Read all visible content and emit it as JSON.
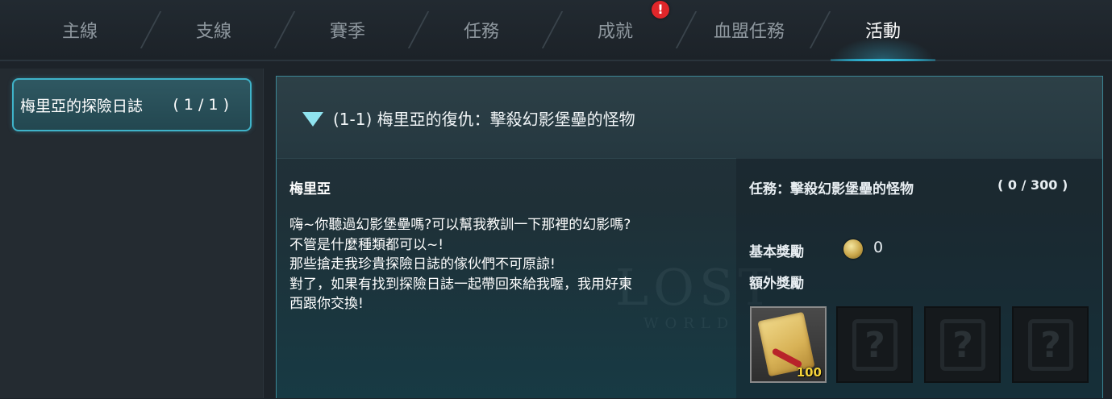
{
  "tabs": [
    {
      "label": "主線"
    },
    {
      "label": "支線"
    },
    {
      "label": "賽季"
    },
    {
      "label": "任務"
    },
    {
      "label": "成就"
    },
    {
      "label": "血盟任務"
    },
    {
      "label": "活動"
    }
  ],
  "alert_icon_glyph": "!",
  "sidebar": {
    "items": [
      {
        "label": "梅里亞的探險日誌",
        "count": "( 1 / 1 )"
      }
    ]
  },
  "quest": {
    "title": "(1-1) 梅里亞的復仇：擊殺幻影堡壘的怪物",
    "npc": "梅里亞",
    "dialogue": [
      "嗨~你聽過幻影堡壘嗎?可以幫我教訓一下那裡的幻影嗎?",
      "不管是什麼種類都可以~!",
      "那些搶走我珍貴探險日誌的傢伙們不可原諒!",
      "對了，如果有找到探險日誌一起帶回來給我喔，我用好東",
      "西跟你交換!"
    ],
    "task_label": "任務：擊殺幻影堡壘的怪物",
    "task_progress": "( 0 / 300 )",
    "basic_reward_label": "基本獎勵",
    "basic_reward_value": "0",
    "extra_reward_label": "額外獎勵",
    "reward_slots": [
      {
        "icon": "scroll-icon",
        "qty": "100"
      },
      {
        "icon": "mystery-gift-icon",
        "glyph": "?"
      },
      {
        "icon": "mystery-gift-icon",
        "glyph": "?"
      },
      {
        "icon": "mystery-gift-icon",
        "glyph": "?"
      }
    ]
  },
  "colors": {
    "accent": "#3fb3c9",
    "alert": "#e0262a",
    "qty": "#f3d13a"
  }
}
